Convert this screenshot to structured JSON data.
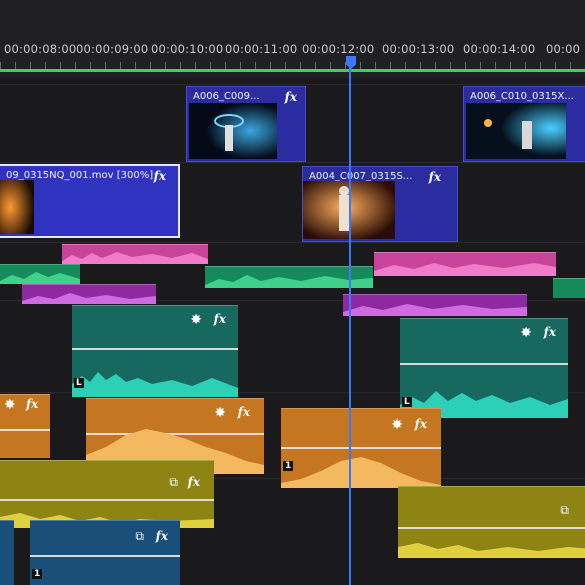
{
  "ruler": {
    "timecodes": [
      "00:00:08:00",
      "00:00:09:00",
      "00:00:10:00",
      "00:00:11:00",
      "00:00:12:00",
      "00:00:13:00",
      "00:00:14:00",
      "00:00"
    ]
  },
  "video_clips": [
    {
      "name": "A006_C009...",
      "fx": "fx"
    },
    {
      "name": "A006_C010_0315X...",
      "fx": "fx"
    },
    {
      "name": "09_0315NQ_001.mov [300%]",
      "fx": "fx"
    },
    {
      "name": "A004_C007_0315S...",
      "fx": "fx"
    }
  ],
  "audio": {
    "fx": "fx",
    "clip_markers": [
      "L",
      "L",
      "1",
      "1"
    ]
  },
  "colors": {
    "video": "#2b2ca0",
    "pink": "#d94fa8",
    "green": "#1fa06a",
    "magenta": "#a030b0",
    "teal": "#1e8a7c",
    "orange": "#d98a2a",
    "olive": "#b8a820",
    "blue_audio": "#1e5a8a",
    "playhead": "#3b78ff",
    "workarea": "#3fd34a"
  }
}
